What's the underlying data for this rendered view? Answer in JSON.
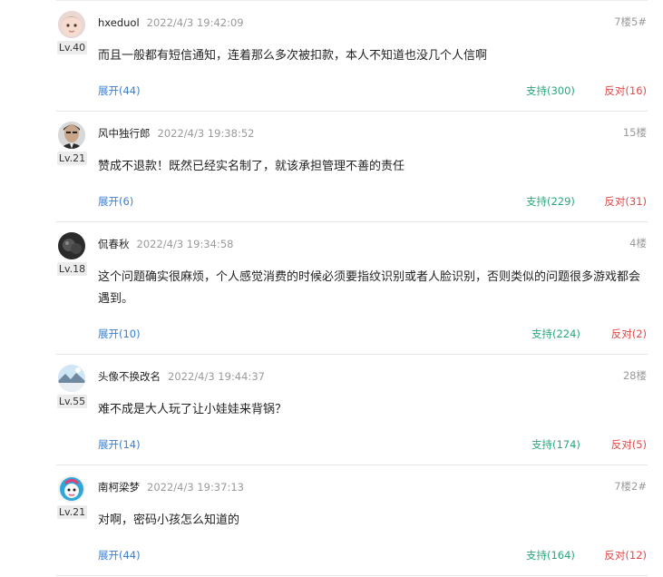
{
  "comments": [
    {
      "user": "hxeduol",
      "time": "2022/4/3 19:42:09",
      "floor": "7楼5#",
      "level": "Lv.40",
      "text": "而且一般都有短信通知，连着那么多次被扣款，本人不知道也没几个人信啊",
      "expand": "展开(44)",
      "support": "支持(300)",
      "oppose": "反对(16)"
    },
    {
      "user": "风中独行郎",
      "time": "2022/4/3 19:38:52",
      "floor": "15楼",
      "level": "Lv.21",
      "text": "赞成不退款！既然已经实名制了，就该承担管理不善的责任",
      "expand": "展开(6)",
      "support": "支持(229)",
      "oppose": "反对(31)"
    },
    {
      "user": "侃春秋",
      "time": "2022/4/3 19:34:58",
      "floor": "4楼",
      "level": "Lv.18",
      "text": "这个问题确实很麻烦，个人感觉消费的时候必须要指纹识别或者人脸识别，否则类似的问题很多游戏都会遇到。",
      "expand": "展开(10)",
      "support": "支持(224)",
      "oppose": "反对(2)"
    },
    {
      "user": "头像不换改名",
      "time": "2022/4/3 19:44:37",
      "floor": "28楼",
      "level": "Lv.55",
      "text": "难不成是大人玩了让小娃娃来背锅？",
      "expand": "展开(14)",
      "support": "支持(174)",
      "oppose": "反对(5)"
    },
    {
      "user": "南柯梁梦",
      "time": "2022/4/3 19:37:13",
      "floor": "7楼2#",
      "level": "Lv.21",
      "text": "对啊，密码小孩怎么知道的",
      "expand": "展开(44)",
      "support": "支持(164)",
      "oppose": "反对(12)"
    }
  ],
  "colors": {
    "expand": "#3a7fd1",
    "support": "#28a67a",
    "oppose": "#e14a4a",
    "time": "#9a9a9a"
  },
  "icons": [
    "avatar-baby-icon",
    "avatar-man-icon",
    "avatar-dark-icon",
    "avatar-landscape-icon",
    "avatar-cartoon-icon"
  ]
}
